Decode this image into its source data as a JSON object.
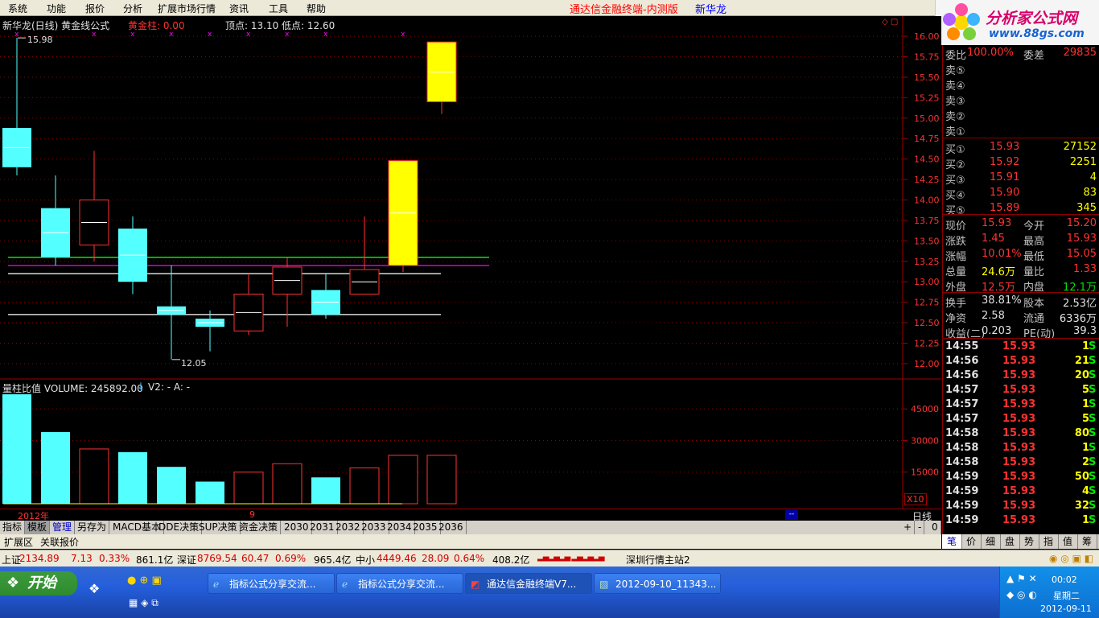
{
  "menu": {
    "items": [
      "系统",
      "功能",
      "报价",
      "分析",
      "扩展市场行情",
      "资讯",
      "工具",
      "帮助"
    ],
    "app_title": "通达信金融终端-内测版",
    "stock_name": "新华龙"
  },
  "logo": {
    "text": "分析家公式网",
    "url": "www.88gs.com"
  },
  "chart": {
    "header_title": "新华龙(日线) 黄金线公式",
    "gold_label": "黄金柱: 0.00",
    "peak_label": "顶点: 13.10 低点: 12.60",
    "high_mark": "15.98",
    "low_mark": "12.05",
    "price_axis": [
      "16.00",
      "15.75",
      "15.50",
      "15.25",
      "15.00",
      "14.75",
      "14.50",
      "14.25",
      "14.00",
      "13.75",
      "13.50",
      "13.25",
      "13.00",
      "12.75",
      "12.50",
      "12.25",
      "12.00"
    ],
    "volume_header": "量柱比值  VOLUME: 245892.00",
    "volume_v2": "V2: -  A: -",
    "volume_axis": [
      "45000",
      "30000",
      "15000"
    ],
    "volume_unit": "X10",
    "date_year": "2012年",
    "date_month": "9",
    "period_label": "日线",
    "scroll_marker": "--"
  },
  "chart_data": {
    "type": "candlestick",
    "ylim": [
      11.95,
      16.05
    ],
    "candles": [
      {
        "open": 14.4,
        "close": 14.88,
        "high": 15.98,
        "low": 14.3,
        "fill": "cyan"
      },
      {
        "open": 13.3,
        "close": 13.9,
        "high": 14.3,
        "low": 13.2,
        "fill": "cyan"
      },
      {
        "open": 13.45,
        "close": 14.0,
        "high": 14.6,
        "low": 13.25,
        "fill": "hollow"
      },
      {
        "open": 13.0,
        "close": 13.65,
        "high": 13.8,
        "low": 12.85,
        "fill": "cyan"
      },
      {
        "open": 12.7,
        "close": 12.6,
        "high": 13.2,
        "low": 12.05,
        "fill": "cyan"
      },
      {
        "open": 12.45,
        "close": 12.55,
        "high": 12.65,
        "low": 12.15,
        "fill": "cyan"
      },
      {
        "open": 12.4,
        "close": 12.85,
        "high": 13.1,
        "low": 12.35,
        "fill": "hollow"
      },
      {
        "open": 12.85,
        "close": 13.18,
        "high": 13.3,
        "low": 12.45,
        "fill": "hollow"
      },
      {
        "open": 12.6,
        "close": 12.9,
        "high": 13.1,
        "low": 12.55,
        "fill": "cyan"
      },
      {
        "open": 12.85,
        "close": 13.15,
        "high": 13.8,
        "low": 12.85,
        "fill": "hollow"
      },
      {
        "open": 13.2,
        "close": 14.48,
        "high": 14.48,
        "low": 13.12,
        "fill": "yellow"
      },
      {
        "open": 15.2,
        "close": 15.93,
        "high": 15.93,
        "low": 15.05,
        "fill": "yellow"
      }
    ],
    "hlines": [
      {
        "value": 13.3,
        "color": "#00ff00"
      },
      {
        "value": 13.2,
        "color": "#ff00ff"
      },
      {
        "value": 13.1,
        "color": "#ffffff"
      },
      {
        "value": 12.6,
        "color": "#ffffff"
      }
    ],
    "volume": {
      "ylim": [
        0,
        55000
      ],
      "values": [
        52000,
        34000,
        26000,
        24500,
        17500,
        10500,
        15000,
        19000,
        12500,
        17000,
        23000,
        23000
      ],
      "fill": [
        "cyan",
        "cyan",
        "hollow",
        "cyan",
        "cyan",
        "cyan",
        "hollow",
        "hollow",
        "cyan",
        "hollow",
        "hollow",
        "hollow"
      ]
    }
  },
  "right_panel": {
    "top_row": {
      "label": "委比",
      "value": "100.00%",
      "label2": "委差",
      "value2": "29835"
    },
    "sells": [
      "卖⑤",
      "卖④",
      "卖③",
      "卖②",
      "卖①"
    ],
    "buys": [
      {
        "label": "买①",
        "price": "15.93",
        "vol": "27152"
      },
      {
        "label": "买②",
        "price": "15.92",
        "vol": "2251"
      },
      {
        "label": "买③",
        "price": "15.91",
        "vol": "4"
      },
      {
        "label": "买④",
        "price": "15.90",
        "vol": "83"
      },
      {
        "label": "买⑤",
        "price": "15.89",
        "vol": "345"
      }
    ],
    "quotes": [
      {
        "l1": "现价",
        "v1": "15.93",
        "l2": "今开",
        "v2": "15.20"
      },
      {
        "l1": "涨跌",
        "v1": "1.45",
        "l2": "最高",
        "v2": "15.93"
      },
      {
        "l1": "涨幅",
        "v1": "10.01%",
        "l2": "最低",
        "v2": "15.05"
      },
      {
        "l1": "总量",
        "v1": "24.6万",
        "l2": "量比",
        "v2": "1.33"
      },
      {
        "l1": "外盘",
        "v1": "12.5万",
        "l2": "内盘",
        "v2": "12.1万"
      }
    ],
    "fundamentals": [
      {
        "l1": "换手",
        "v1": "38.81%",
        "l2": "股本",
        "v2": "2.53亿"
      },
      {
        "l1": "净资",
        "v1": "2.58",
        "l2": "流通",
        "v2": "6336万"
      },
      {
        "l1": "收益(二)",
        "v1": "0.203",
        "l2": "PE(动)",
        "v2": "39.3"
      }
    ],
    "ticks": [
      {
        "time": "14:55",
        "price": "15.93",
        "vol": "1",
        "side": "S"
      },
      {
        "time": "14:56",
        "price": "15.93",
        "vol": "21",
        "side": "S"
      },
      {
        "time": "14:56",
        "price": "15.93",
        "vol": "20",
        "side": "S"
      },
      {
        "time": "14:57",
        "price": "15.93",
        "vol": "5",
        "side": "S"
      },
      {
        "time": "14:57",
        "price": "15.93",
        "vol": "1",
        "side": "S"
      },
      {
        "time": "14:57",
        "price": "15.93",
        "vol": "5",
        "side": "S"
      },
      {
        "time": "14:58",
        "price": "15.93",
        "vol": "80",
        "side": "S"
      },
      {
        "time": "14:58",
        "price": "15.93",
        "vol": "1",
        "side": "S"
      },
      {
        "time": "14:58",
        "price": "15.93",
        "vol": "2",
        "side": "S"
      },
      {
        "time": "14:59",
        "price": "15.93",
        "vol": "50",
        "side": "S"
      },
      {
        "time": "14:59",
        "price": "15.93",
        "vol": "4",
        "side": "S"
      },
      {
        "time": "14:59",
        "price": "15.93",
        "vol": "32",
        "side": "S"
      },
      {
        "time": "14:59",
        "price": "15.93",
        "vol": "1",
        "side": "S"
      }
    ],
    "tabs": [
      "笔",
      "价",
      "细",
      "盘",
      "势",
      "指",
      "值",
      "筹"
    ]
  },
  "bottom_tabs": [
    "指标",
    "模板",
    "管理",
    "另存为",
    "MACD基本",
    "DDE决策",
    "SUP决策",
    "资金决策",
    "2030",
    "2031",
    "2032",
    "2033",
    "2034",
    "2035",
    "2036"
  ],
  "bottom_controls": [
    "+",
    "-",
    "0"
  ],
  "ext_tabs": [
    "扩展区",
    "关联报价"
  ],
  "status": {
    "sh_label": "上证",
    "sh_val": "2134.89",
    "sh_chg": "7.13",
    "sh_pct": "0.33%",
    "sh_amt": "861.1亿",
    "sz_label": "深证",
    "sz_val": "8769.54",
    "sz_chg": "60.47",
    "sz_pct": "0.69%",
    "sz_amt": "965.4亿",
    "zx_label": "中小",
    "zx_val": "4449.46",
    "zx_chg": "28.09",
    "zx_pct": "0.64%",
    "zx_amt": "408.2亿",
    "server": "深圳行情主站2"
  },
  "taskbar": {
    "start": "开始",
    "tasks": [
      "指标公式分享交流...",
      "指标公式分享交流...",
      "通达信金融终端V7...",
      "2012-09-10_11343..."
    ],
    "time": "00:02",
    "weekday": "星期二",
    "date": "2012-09-11"
  }
}
